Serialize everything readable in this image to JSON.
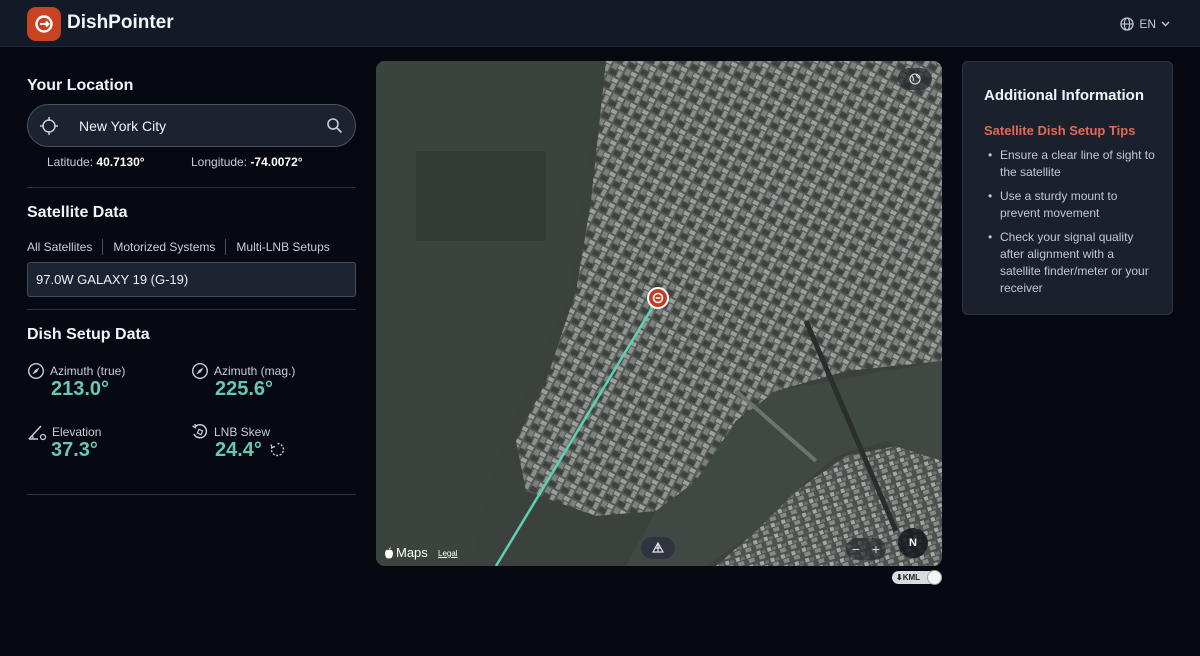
{
  "header": {
    "brand": "DishPointer",
    "language": "EN"
  },
  "location": {
    "title": "Your Location",
    "search_value": "New York City",
    "latitude_label": "Latitude:",
    "latitude_value": "40.7130°",
    "longitude_label": "Longitude:",
    "longitude_value": "-74.0072°"
  },
  "satellite": {
    "title": "Satellite Data",
    "filters": [
      "All Satellites",
      "Motorized Systems",
      "Multi-LNB Setups"
    ],
    "selected": "97.0W GALAXY 19 (G-19)"
  },
  "dish": {
    "title": "Dish Setup Data",
    "azimuth_true_label": "Azimuth (true)",
    "azimuth_true_value": "213.0°",
    "azimuth_mag_label": "Azimuth (mag.)",
    "azimuth_mag_value": "225.6°",
    "elevation_label": "Elevation",
    "elevation_value": "37.3°",
    "lnb_skew_label": "LNB Skew",
    "lnb_skew_value": "24.4°"
  },
  "map": {
    "maps_label": "Maps",
    "legal": "Legal",
    "compass": "N",
    "kml": "KML",
    "beam_color": "#5fd0b4",
    "pin_color": "#c43d22"
  },
  "info": {
    "title": "Additional Information",
    "subtitle": "Satellite Dish Setup Tips",
    "tips": [
      "Ensure a clear line of sight to the satellite",
      "Use a sturdy mount to prevent movement",
      "Check your signal quality after alignment with a satellite finder/meter or your receiver"
    ]
  }
}
